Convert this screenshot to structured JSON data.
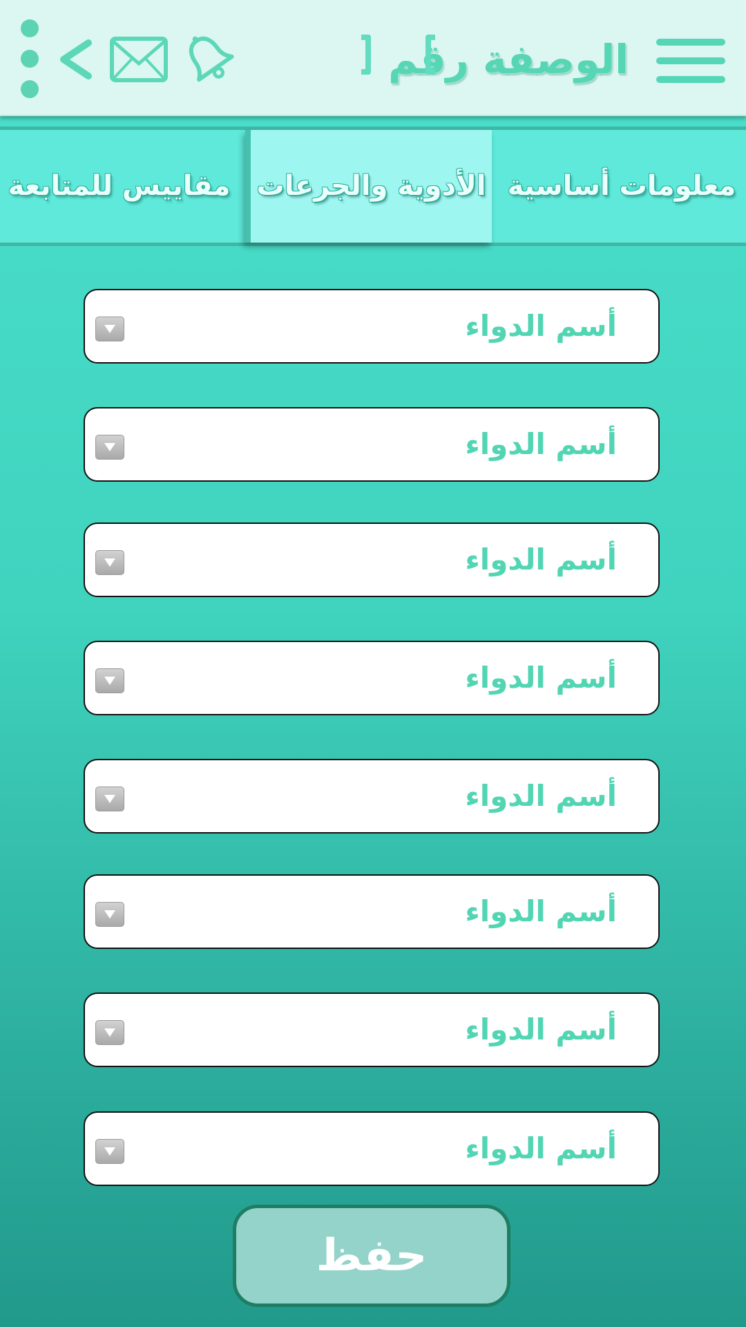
{
  "header": {
    "title": "الوصفة رقم",
    "title_value": "",
    "icons": [
      "menu-icon",
      "bell-icon",
      "mail-icon",
      "back-icon",
      "more-icon"
    ]
  },
  "tabs": [
    {
      "label": "معلومات أساسية",
      "active": false
    },
    {
      "label": "الأدوية والجرعات",
      "active": true
    },
    {
      "label": "مقاييس للمتابعة",
      "active": false
    }
  ],
  "medications": [
    {
      "label": "أسم الدواء"
    },
    {
      "label": "أسم الدواء"
    },
    {
      "label": "أسم الدواء"
    },
    {
      "label": "أسم الدواء"
    },
    {
      "label": "أسم الدواء"
    },
    {
      "label": "أسم الدواء"
    },
    {
      "label": "أسم الدواء"
    },
    {
      "label": "أسم الدواء"
    }
  ],
  "save_label": "حفظ",
  "colors": {
    "accent": "#55d6b6",
    "header_bg": "#dcf6f2",
    "tab_bg": "#5ee9da",
    "active_tab_bg": "#9ef6f1",
    "save_button_bg": "#93d3c9"
  }
}
